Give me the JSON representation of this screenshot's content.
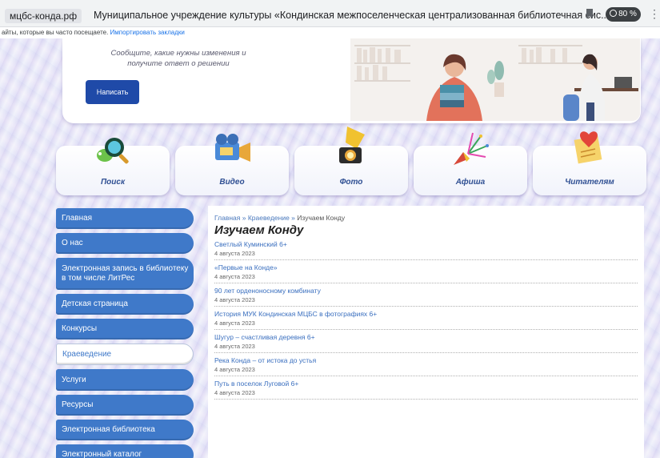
{
  "browser": {
    "domain": "мцбс-конда.рф",
    "tab_title": "Муниципальное учреждение культуры «Кондинская межпоселенческая централизованная библиотечная сис...",
    "zoom": "80 %",
    "bookmarks_hint": "айты, которые вы часто посещаете.",
    "import_bookmarks": "Импортировать закладки"
  },
  "banner": {
    "text": "Сообщите, какие нужны изменения и получите ответ о решении",
    "write_button": "Написать"
  },
  "icon_nav": [
    {
      "label": "Поиск",
      "icon": "magnifier-bug-icon"
    },
    {
      "label": "Видео",
      "icon": "video-camera-icon"
    },
    {
      "label": "Фото",
      "icon": "photo-camera-icon"
    },
    {
      "label": "Афиша",
      "icon": "firework-icon"
    },
    {
      "label": "Читателям",
      "icon": "letter-heart-icon"
    }
  ],
  "sidebar": {
    "items": [
      {
        "label": "Главная"
      },
      {
        "label": "О нас"
      },
      {
        "label": "Электронная запись в библиотеку в том числе ЛитРес"
      },
      {
        "label": "Детская страница"
      },
      {
        "label": "Конкурсы"
      },
      {
        "label": "Краеведение"
      },
      {
        "label": "Услуги"
      },
      {
        "label": "Ресурсы"
      },
      {
        "label": "Электронная библиотека"
      },
      {
        "label": "Электронный каталог"
      }
    ]
  },
  "breadcrumb": {
    "home": "Главная",
    "sep": "»",
    "section": "Краеведение",
    "current": "Изучаем Конду"
  },
  "page_title": "Изучаем Конду",
  "articles": [
    {
      "title": "Светлый Куминский 6+",
      "date": "4 августа 2023"
    },
    {
      "title": "«Первые на Конде»",
      "date": "4 августа 2023"
    },
    {
      "title": "90 лет орденоносному комбинату",
      "date": "4 августа 2023"
    },
    {
      "title": "История МУК Кондинская МЦБС в фотографиях 6+",
      "date": "4 августа 2023"
    },
    {
      "title": "Шугур – счастливая деревня 6+",
      "date": "4 августа 2023"
    },
    {
      "title": "Река Конда – от истока до устья",
      "date": "4 августа 2023"
    },
    {
      "title": "Путь в поселок Луговой 6+",
      "date": "4 августа 2023"
    }
  ]
}
